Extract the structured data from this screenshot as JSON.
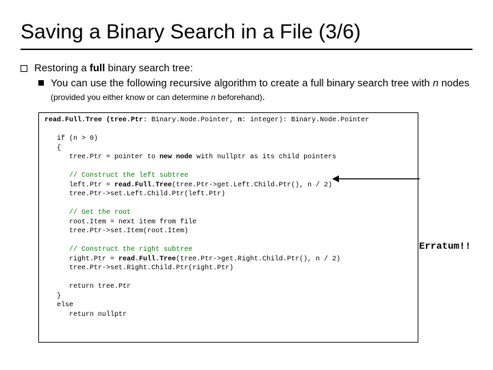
{
  "title": "Saving a Binary Search in a File (3/6)",
  "bullet1_prefix": "Restoring a ",
  "bullet1_bold": "full",
  "bullet1_suffix": " binary search tree:",
  "sub1_a": "You can use the following recursive algorithm to create a full binary search tree with ",
  "sub1_n": "n",
  "sub1_b": " nodes ",
  "sub1_small_a": "(provided you either know or can determine ",
  "sub1_small_n": "n",
  "sub1_small_b": " beforehand)",
  "sub1_period": ".",
  "code": {
    "l1a": "read.Full.Tree",
    "l1b": " (tree.Ptr",
    "l1c": ": Binary.Node.Pointer, ",
    "l1d": "n",
    "l1e": ": integer): Binary.Node.Pointer",
    "l2": "",
    "l3": "   if (n > 0)",
    "l4": "   {",
    "l5a": "      tree.Ptr = pointer to ",
    "l5b": "new node",
    "l5c": " with nullptr as its child pointers",
    "l6": "",
    "l7": "      // Construct the left subtree",
    "l8a": "      left.Ptr = ",
    "l8b": "read.Full.Tree",
    "l8c": "(tree.Ptr->get.Left.Child.Ptr(), n / 2)",
    "l9": "      tree.Ptr->set.Left.Child.Ptr(left.Ptr)",
    "l10": "",
    "l11": "      // Get the root",
    "l12": "      root.Item = next item from file",
    "l13": "      tree.Ptr->set.Item(root.Item)",
    "l14": "",
    "l15": "      // Construct the right subtree",
    "l16a": "      right.Ptr = ",
    "l16b": "read.Full.Tree",
    "l16c": "(tree.Ptr->get.Right.Child.Ptr(), n / 2)",
    "l17": "      tree.Ptr->set.Right.Child.Ptr(right.Ptr)",
    "l18": "",
    "l19": "      return tree.Ptr",
    "l20": "   }",
    "l21": "   else",
    "l22": "      return nullptr"
  },
  "erratum": "Erratum!!"
}
